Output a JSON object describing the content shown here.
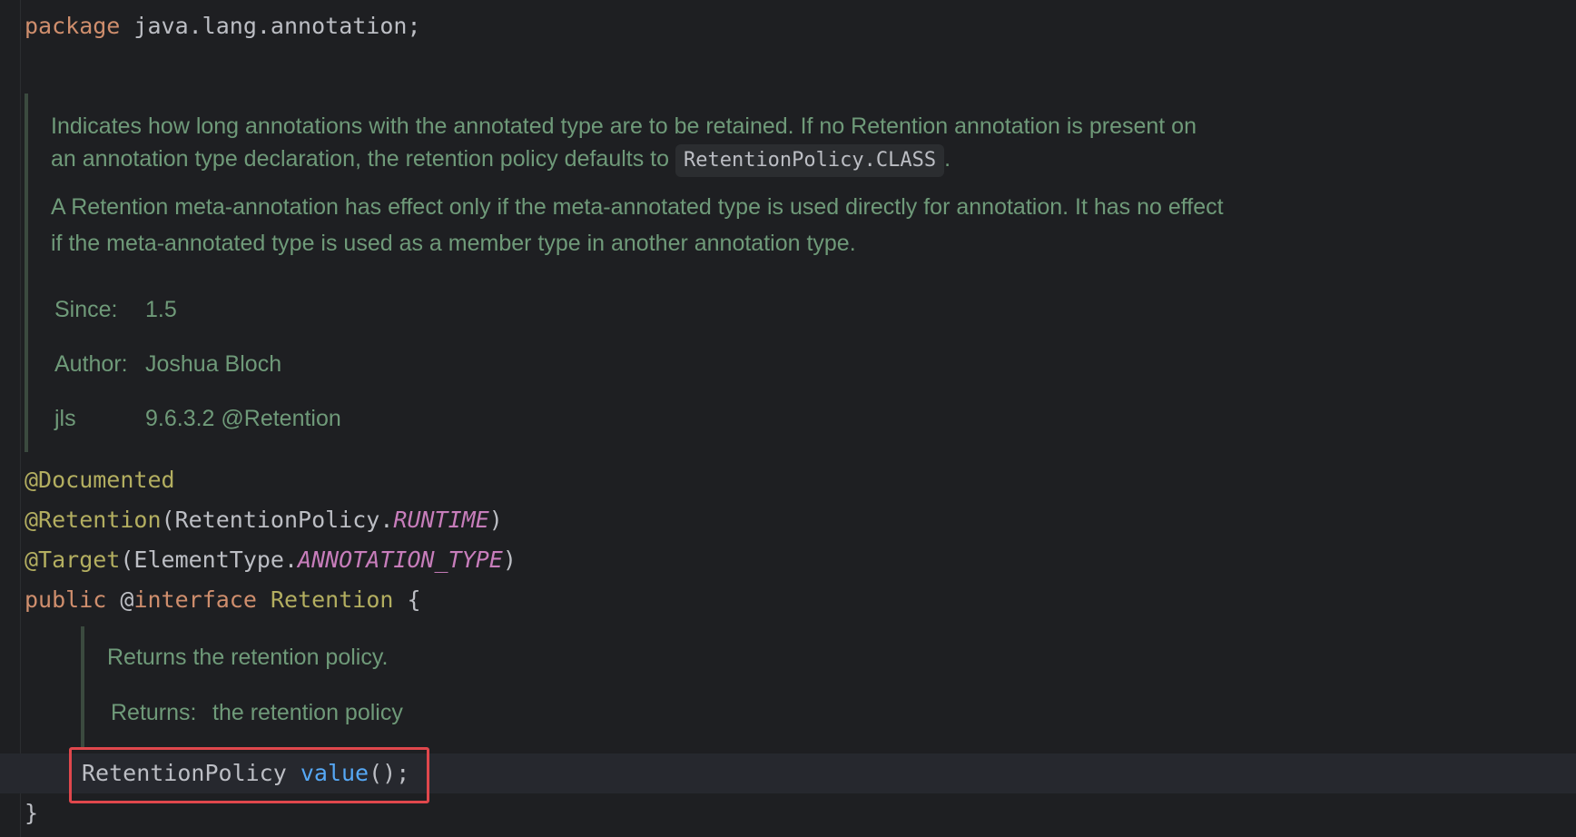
{
  "code": {
    "package_kw": "package",
    "package_name": "java.lang.annotation;",
    "ann_documented": "@Documented",
    "ann_retention": "@Retention",
    "retention_open": "(RetentionPolicy.",
    "retention_const": "RUNTIME",
    "retention_close": ")",
    "ann_target": "@Target",
    "target_open": "(ElementType.",
    "target_const": "ANNOTATION_TYPE",
    "target_close": ")",
    "public_kw": "public",
    "at_sign": "@",
    "interface_kw": "interface",
    "class_name": "Retention",
    "open_brace": "{",
    "method_type": "RetentionPolicy",
    "method_name": "value",
    "method_tail": "();",
    "close_brace": "}"
  },
  "class_doc": {
    "para1_text": "Indicates how long annotations with the annotated type are to be retained. If no Retention annotation is present on an annotation type declaration, the retention policy defaults to ",
    "para1_code": "RetentionPolicy.CLASS",
    "para1_end": ".",
    "para2_text": "A Retention meta-annotation has effect only if the meta-annotated type is used directly for annotation. It has no effect if the meta-annotated type is used as a member type in another annotation type.",
    "tags": [
      {
        "label": "Since:",
        "value": "1.5"
      },
      {
        "label": "Author:",
        "value": "Joshua Bloch"
      },
      {
        "label": "jls",
        "value": "9.6.3.2 @Retention"
      }
    ]
  },
  "method_doc": {
    "description": "Returns the retention policy.",
    "returns_label": "Returns:",
    "returns_value": "the retention policy"
  },
  "colors": {
    "background": "#1e1f22",
    "keyword": "#cf8e6d",
    "annotation": "#b3ae60",
    "constant": "#c77dbb",
    "method": "#56a8f5",
    "doc_text": "#6f9a79",
    "highlight_border": "#e0474c"
  }
}
